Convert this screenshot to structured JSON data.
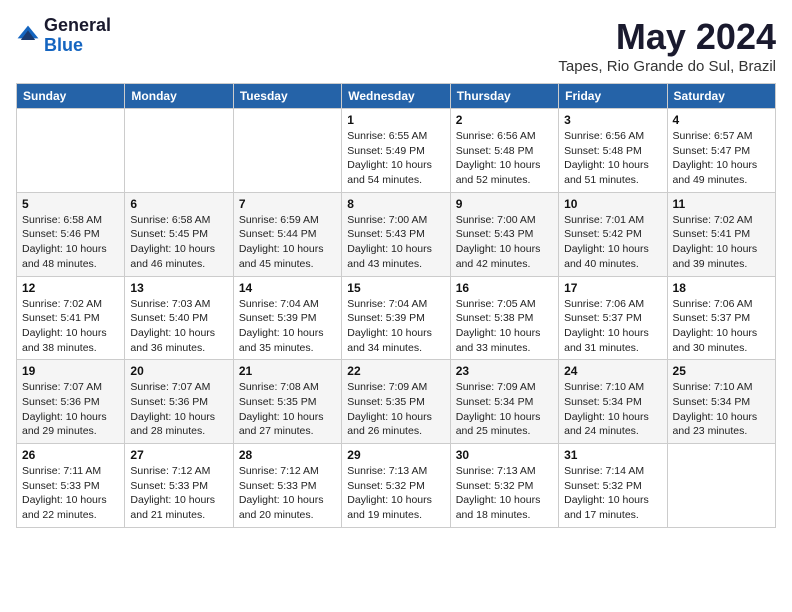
{
  "header": {
    "logo_general": "General",
    "logo_blue": "Blue",
    "month_title": "May 2024",
    "location": "Tapes, Rio Grande do Sul, Brazil"
  },
  "weekdays": [
    "Sunday",
    "Monday",
    "Tuesday",
    "Wednesday",
    "Thursday",
    "Friday",
    "Saturday"
  ],
  "weeks": [
    [
      {
        "day": "",
        "info": ""
      },
      {
        "day": "",
        "info": ""
      },
      {
        "day": "",
        "info": ""
      },
      {
        "day": "1",
        "info": "Sunrise: 6:55 AM\nSunset: 5:49 PM\nDaylight: 10 hours\nand 54 minutes."
      },
      {
        "day": "2",
        "info": "Sunrise: 6:56 AM\nSunset: 5:48 PM\nDaylight: 10 hours\nand 52 minutes."
      },
      {
        "day": "3",
        "info": "Sunrise: 6:56 AM\nSunset: 5:48 PM\nDaylight: 10 hours\nand 51 minutes."
      },
      {
        "day": "4",
        "info": "Sunrise: 6:57 AM\nSunset: 5:47 PM\nDaylight: 10 hours\nand 49 minutes."
      }
    ],
    [
      {
        "day": "5",
        "info": "Sunrise: 6:58 AM\nSunset: 5:46 PM\nDaylight: 10 hours\nand 48 minutes."
      },
      {
        "day": "6",
        "info": "Sunrise: 6:58 AM\nSunset: 5:45 PM\nDaylight: 10 hours\nand 46 minutes."
      },
      {
        "day": "7",
        "info": "Sunrise: 6:59 AM\nSunset: 5:44 PM\nDaylight: 10 hours\nand 45 minutes."
      },
      {
        "day": "8",
        "info": "Sunrise: 7:00 AM\nSunset: 5:43 PM\nDaylight: 10 hours\nand 43 minutes."
      },
      {
        "day": "9",
        "info": "Sunrise: 7:00 AM\nSunset: 5:43 PM\nDaylight: 10 hours\nand 42 minutes."
      },
      {
        "day": "10",
        "info": "Sunrise: 7:01 AM\nSunset: 5:42 PM\nDaylight: 10 hours\nand 40 minutes."
      },
      {
        "day": "11",
        "info": "Sunrise: 7:02 AM\nSunset: 5:41 PM\nDaylight: 10 hours\nand 39 minutes."
      }
    ],
    [
      {
        "day": "12",
        "info": "Sunrise: 7:02 AM\nSunset: 5:41 PM\nDaylight: 10 hours\nand 38 minutes."
      },
      {
        "day": "13",
        "info": "Sunrise: 7:03 AM\nSunset: 5:40 PM\nDaylight: 10 hours\nand 36 minutes."
      },
      {
        "day": "14",
        "info": "Sunrise: 7:04 AM\nSunset: 5:39 PM\nDaylight: 10 hours\nand 35 minutes."
      },
      {
        "day": "15",
        "info": "Sunrise: 7:04 AM\nSunset: 5:39 PM\nDaylight: 10 hours\nand 34 minutes."
      },
      {
        "day": "16",
        "info": "Sunrise: 7:05 AM\nSunset: 5:38 PM\nDaylight: 10 hours\nand 33 minutes."
      },
      {
        "day": "17",
        "info": "Sunrise: 7:06 AM\nSunset: 5:37 PM\nDaylight: 10 hours\nand 31 minutes."
      },
      {
        "day": "18",
        "info": "Sunrise: 7:06 AM\nSunset: 5:37 PM\nDaylight: 10 hours\nand 30 minutes."
      }
    ],
    [
      {
        "day": "19",
        "info": "Sunrise: 7:07 AM\nSunset: 5:36 PM\nDaylight: 10 hours\nand 29 minutes."
      },
      {
        "day": "20",
        "info": "Sunrise: 7:07 AM\nSunset: 5:36 PM\nDaylight: 10 hours\nand 28 minutes."
      },
      {
        "day": "21",
        "info": "Sunrise: 7:08 AM\nSunset: 5:35 PM\nDaylight: 10 hours\nand 27 minutes."
      },
      {
        "day": "22",
        "info": "Sunrise: 7:09 AM\nSunset: 5:35 PM\nDaylight: 10 hours\nand 26 minutes."
      },
      {
        "day": "23",
        "info": "Sunrise: 7:09 AM\nSunset: 5:34 PM\nDaylight: 10 hours\nand 25 minutes."
      },
      {
        "day": "24",
        "info": "Sunrise: 7:10 AM\nSunset: 5:34 PM\nDaylight: 10 hours\nand 24 minutes."
      },
      {
        "day": "25",
        "info": "Sunrise: 7:10 AM\nSunset: 5:34 PM\nDaylight: 10 hours\nand 23 minutes."
      }
    ],
    [
      {
        "day": "26",
        "info": "Sunrise: 7:11 AM\nSunset: 5:33 PM\nDaylight: 10 hours\nand 22 minutes."
      },
      {
        "day": "27",
        "info": "Sunrise: 7:12 AM\nSunset: 5:33 PM\nDaylight: 10 hours\nand 21 minutes."
      },
      {
        "day": "28",
        "info": "Sunrise: 7:12 AM\nSunset: 5:33 PM\nDaylight: 10 hours\nand 20 minutes."
      },
      {
        "day": "29",
        "info": "Sunrise: 7:13 AM\nSunset: 5:32 PM\nDaylight: 10 hours\nand 19 minutes."
      },
      {
        "day": "30",
        "info": "Sunrise: 7:13 AM\nSunset: 5:32 PM\nDaylight: 10 hours\nand 18 minutes."
      },
      {
        "day": "31",
        "info": "Sunrise: 7:14 AM\nSunset: 5:32 PM\nDaylight: 10 hours\nand 17 minutes."
      },
      {
        "day": "",
        "info": ""
      }
    ]
  ]
}
